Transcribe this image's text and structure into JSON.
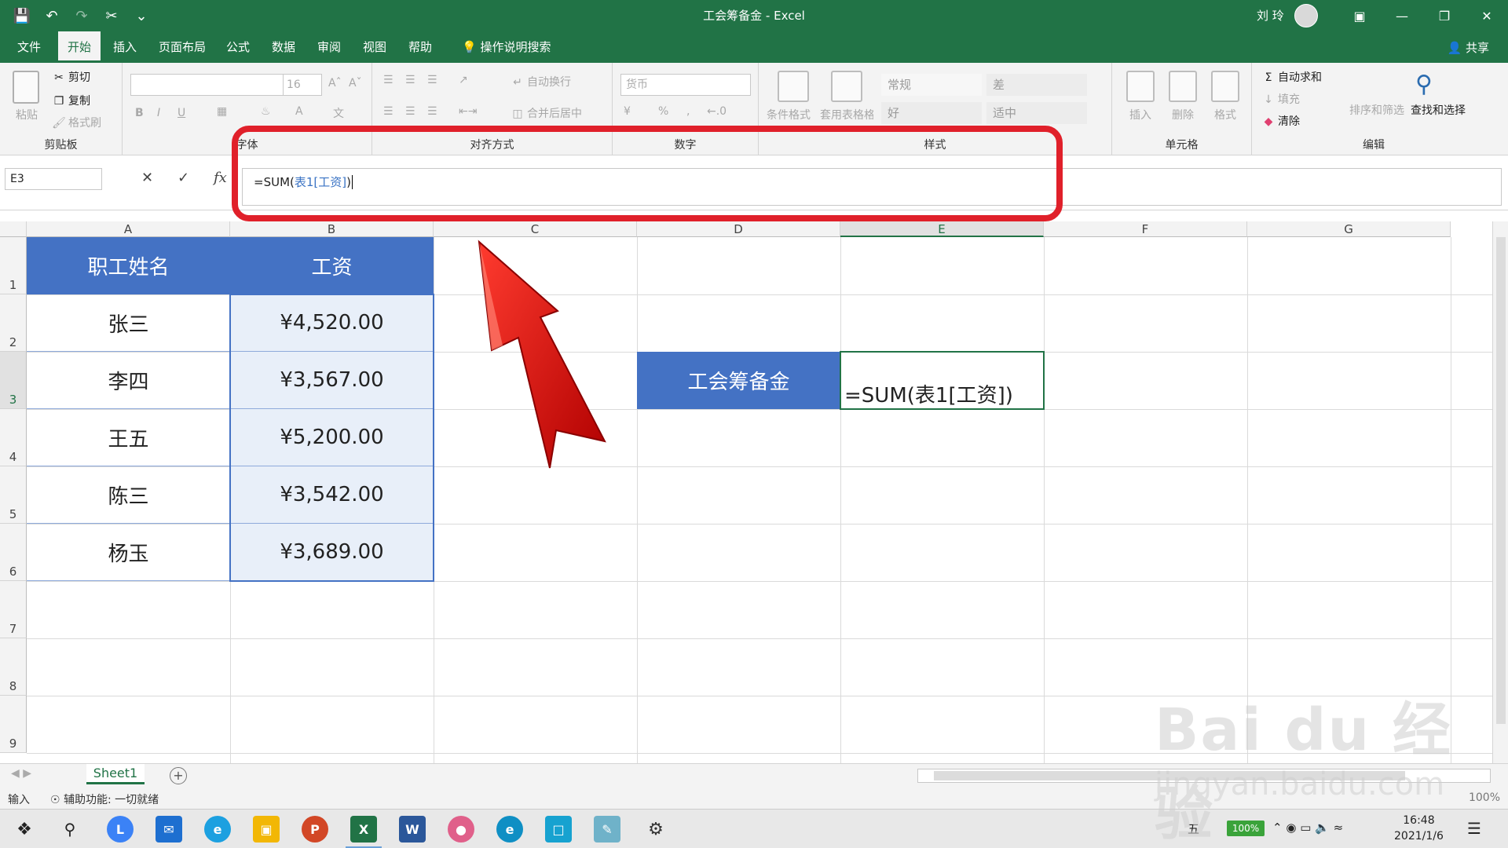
{
  "window": {
    "title": "工会筹备金  -  Excel",
    "user": "刘 玲"
  },
  "quick_access": {
    "icons": [
      "save-icon",
      "undo-icon",
      "redo-icon",
      "cut-icon",
      "customize-icon"
    ]
  },
  "tabs": [
    {
      "label": "文件"
    },
    {
      "label": "开始"
    },
    {
      "label": "插入"
    },
    {
      "label": "页面布局"
    },
    {
      "label": "公式"
    },
    {
      "label": "数据"
    },
    {
      "label": "审阅"
    },
    {
      "label": "视图"
    },
    {
      "label": "帮助"
    },
    {
      "label": "操作说明搜索"
    }
  ],
  "share_label": "共享",
  "ribbon": {
    "clipboard": {
      "paste": "粘贴",
      "cut": "剪切",
      "copy": "复制",
      "format_painter": "格式刷",
      "label": "剪贴板"
    },
    "font": {
      "size": "16",
      "label": "字体",
      "bold": "B",
      "italic": "I",
      "underline": "U"
    },
    "alignment": {
      "wrap": "自动换行",
      "merge": "合并后居中",
      "label": "对齐方式"
    },
    "number": {
      "format": "货币",
      "percent": "%",
      "label": "数字"
    },
    "styles": {
      "conditional": "条件格式",
      "table": "套用表格格式",
      "normal": "常规",
      "bad": "差",
      "good": "好",
      "neutral": "适中",
      "label": "样式"
    },
    "cells": {
      "insert": "插入",
      "delete": "删除",
      "format": "格式",
      "label": "单元格"
    },
    "editing": {
      "autosum": "自动求和",
      "fill": "填充",
      "clear": "清除",
      "sort": "排序和筛选",
      "find": "查找和选择",
      "label": "编辑"
    }
  },
  "formula_bar": {
    "name_box": "E3",
    "fx": "fx",
    "formula_prefix": "=SUM(",
    "formula_ref": "表1[工资]",
    "formula_suffix": ")"
  },
  "grid": {
    "columns": [
      "A",
      "B",
      "C",
      "D",
      "E",
      "F",
      "G"
    ],
    "rows": [
      "1",
      "2",
      "3",
      "4",
      "5",
      "6",
      "7",
      "8",
      "9"
    ],
    "table_headers": [
      "职工姓名",
      "工资"
    ],
    "table_rows": [
      {
        "name": "张三",
        "salary": "¥4,520.00"
      },
      {
        "name": "李四",
        "salary": "¥3,567.00"
      },
      {
        "name": "王五",
        "salary": "¥5,200.00"
      },
      {
        "name": "陈三",
        "salary": "¥3,542.00"
      },
      {
        "name": "杨玉",
        "salary": "¥3,689.00"
      }
    ],
    "label_cell": "工会筹备金",
    "active_cell_text": "=SUM(表1[工资])"
  },
  "sheet": {
    "tab": "Sheet1"
  },
  "status": {
    "mode": "输入",
    "accessibility": "辅助功能: 一切就绪",
    "zoom": "100%"
  },
  "taskbar": {
    "time": "16:48",
    "date": "2021/1/6",
    "battery": "100%",
    "ime": "五"
  },
  "watermark": {
    "logo": "Bai du 经验",
    "url": "jingyan.baidu.com"
  },
  "colors": {
    "excel_green": "#217346",
    "table_blue": "#4472c4",
    "highlight_red": "#e0202a"
  }
}
